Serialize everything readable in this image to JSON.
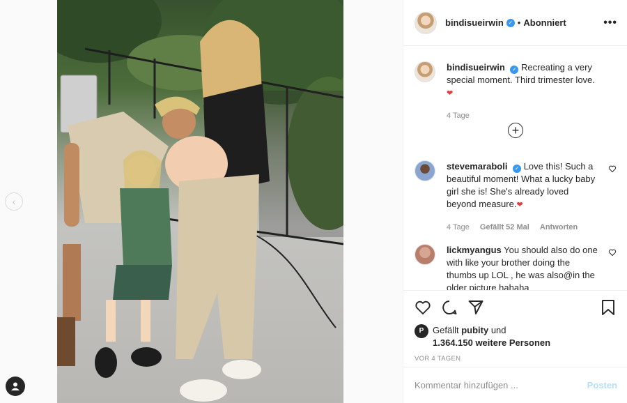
{
  "post": {
    "username": "bindisueirwin",
    "follow_status": "Abonniert",
    "caption": "Recreating a very special moment. Third trimester love.",
    "caption_age": "4 Tage"
  },
  "comments": [
    {
      "username": "stevemaraboli",
      "verified": true,
      "text": "Love this! Such a beautiful moment! What a lucky baby girl she is! She's already loved beyond measure.",
      "age": "4 Tage",
      "likes": "Gefällt 52 Mal",
      "reply": "Antworten"
    },
    {
      "username": "lickmyangus",
      "verified": false,
      "text": "You should also do one with like your brother doing the thumbs up LOL , he was also@in the older picture hahaha"
    }
  ],
  "likes": {
    "prefix": "Gefällt",
    "first_user": "pubity",
    "joiner": "und",
    "others": "1.364.150 weitere Personen"
  },
  "date_label": "VOR 4 TAGEN",
  "comment_box": {
    "placeholder": "Kommentar hinzufügen ...",
    "post_label": "Posten"
  },
  "icons": [
    "heart-icon",
    "comment-icon",
    "share-icon",
    "bookmark-icon",
    "more-icon",
    "verified-icon",
    "add-comment-icon",
    "chevron-left-icon",
    "profile-icon"
  ],
  "colors": {
    "accent": "#3897f0",
    "post_disabled": "#b2dffc",
    "heart_emoji": "#e53a3a",
    "text": "#262626",
    "meta": "#8e8e8e"
  }
}
